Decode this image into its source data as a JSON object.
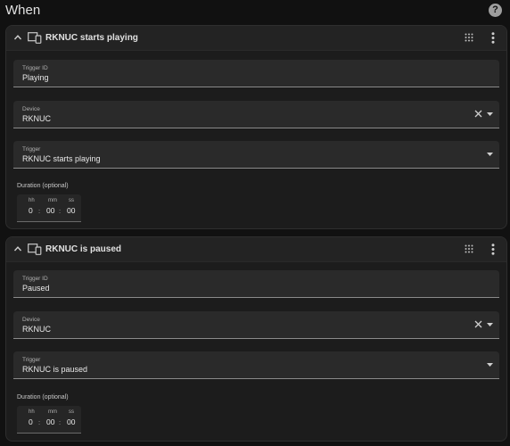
{
  "page": {
    "title": "When",
    "help_icon": "help-circle-icon"
  },
  "triggers": [
    {
      "title": "RKNUC starts playing",
      "trigger_id": {
        "label": "Trigger ID",
        "value": "Playing"
      },
      "device": {
        "label": "Device",
        "value": "RKNUC"
      },
      "trigger": {
        "label": "Trigger",
        "value": "RKNUC starts playing"
      },
      "duration": {
        "label": "Duration (optional)",
        "hh_label": "hh",
        "mm_label": "mm",
        "ss_label": "ss",
        "hh": "0",
        "mm": "00",
        "ss": "00",
        "sep": ":"
      }
    },
    {
      "title": "RKNUC is paused",
      "trigger_id": {
        "label": "Trigger ID",
        "value": "Paused"
      },
      "device": {
        "label": "Device",
        "value": "RKNUC"
      },
      "trigger": {
        "label": "Trigger",
        "value": "RKNUC is paused"
      },
      "duration": {
        "label": "Duration (optional)",
        "hh_label": "hh",
        "mm_label": "mm",
        "ss_label": "ss",
        "hh": "0",
        "mm": "00",
        "ss": "00",
        "sep": ":"
      }
    }
  ],
  "colors": {
    "background": "#111111",
    "card": "#1c1c1c",
    "field": "#2a2a2a",
    "text": "#e1e1e1"
  }
}
